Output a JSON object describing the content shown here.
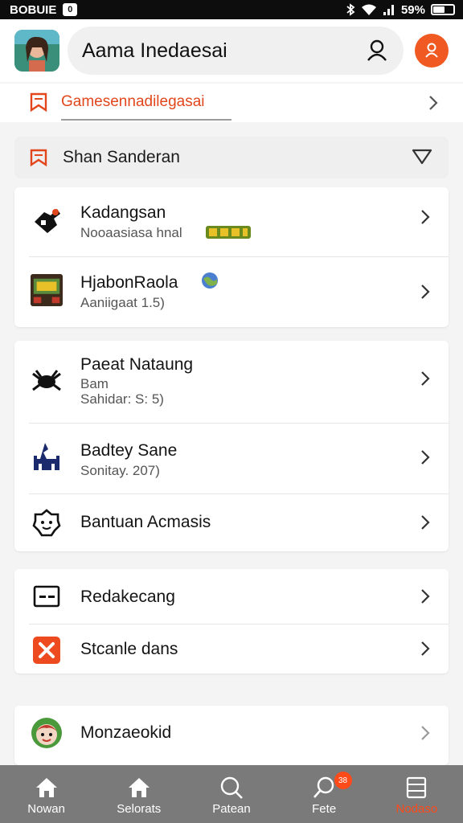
{
  "status_bar": {
    "left_text": "BOBUIE",
    "badge_glyph": "0",
    "battery_text": "59%",
    "battery_level": 0.59
  },
  "header": {
    "search_text": "Aama Inedaesai",
    "icons": [
      "avatar-image",
      "search-icon",
      "profile-icon"
    ]
  },
  "breadcrumb": {
    "label": "Gamesennadilegasai"
  },
  "section": {
    "label": "Shan Sanderan"
  },
  "groups": [
    {
      "items": [
        {
          "title": "Kadangsan",
          "subtitle": "Nooaasiasa hnal",
          "icon": "game-controller-icon"
        },
        {
          "title": "HjabonRaola",
          "subtitle": "Aaniigaat 1.5)",
          "icon": "arcade-icon"
        }
      ]
    },
    {
      "items": [
        {
          "title": "Paeat Nataung",
          "subtitle": "Bam",
          "subtitle2": "Sahidar: S: 5)",
          "icon": "crab-icon"
        },
        {
          "title": "Badtey Sane",
          "subtitle": "Sonitay. 207)",
          "icon": "castle-icon"
        },
        {
          "title": "Bantuan Acmasis",
          "icon": "help-icon"
        }
      ]
    },
    {
      "items": [
        {
          "title": "Redakecang",
          "icon": "card-icon"
        },
        {
          "title": "Stcanle dans",
          "icon": "close-box-icon"
        }
      ]
    },
    {
      "items": [
        {
          "title": "Monzaeokid",
          "icon": "kid-avatar-icon"
        }
      ]
    }
  ],
  "bottom_nav": [
    {
      "label": "Nowan",
      "icon": "home-icon"
    },
    {
      "label": "Selorats",
      "icon": "home-icon"
    },
    {
      "label": "Patean",
      "icon": "search-icon"
    },
    {
      "label": "Fete",
      "icon": "search-icon",
      "badge": "38"
    },
    {
      "label": "Nodaso",
      "icon": "list-icon",
      "active": true
    }
  ],
  "colors": {
    "accent": "#f05a22",
    "active_nav": "#ff4a1a",
    "nav_bg": "#7a7a7a"
  }
}
